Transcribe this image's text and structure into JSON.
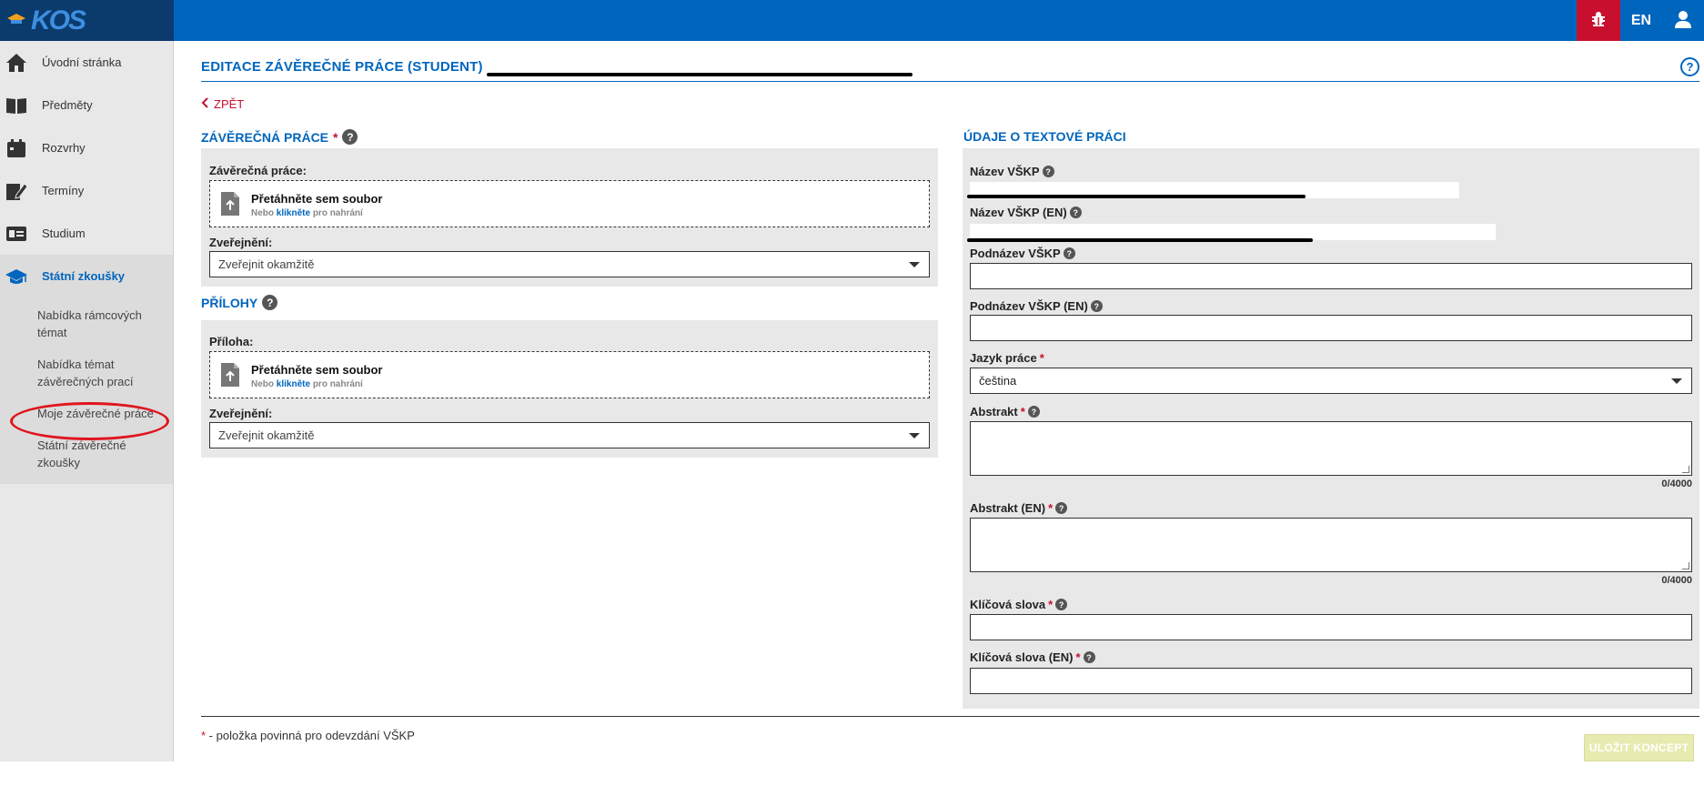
{
  "header": {
    "logo_text": "KOS",
    "lang_label": "EN",
    "brand_color": "#0065bd",
    "bug_color": "#c8102e"
  },
  "sidebar": {
    "items": [
      {
        "label": "Úvodní stránka",
        "icon": "home-icon"
      },
      {
        "label": "Předměty",
        "icon": "book-icon"
      },
      {
        "label": "Rozvrhy",
        "icon": "calendar-icon"
      },
      {
        "label": "Termíny",
        "icon": "edit-icon"
      },
      {
        "label": "Studium",
        "icon": "id-card-icon"
      },
      {
        "label": "Státní zkoušky",
        "icon": "graduation-cap-icon",
        "active": true
      }
    ],
    "subitems": [
      {
        "label": "Nabídka rámcových témat"
      },
      {
        "label": "Nabídka témat závěrečných prací"
      },
      {
        "label": "Moje závěrečné práce",
        "current": true
      },
      {
        "label": "Státní závěrečné zkoušky"
      }
    ]
  },
  "page": {
    "title": "EDITACE ZÁVĚREČNÉ PRÁCE (STUDENT)",
    "back_label": "ZPĚT",
    "help_symbol": "?"
  },
  "thesis_section": {
    "title": "ZÁVĚREČNÁ PRÁCE",
    "required_mark": "*",
    "file_label": "Závěrečná práce:",
    "drop_main": "Přetáhněte sem soubor",
    "drop_sub_prefix": "Nebo",
    "drop_sub_link": "klikněte",
    "drop_sub_suffix": "pro nahrání",
    "publish_label": "Zveřejnění:",
    "publish_value": "Zveřejnit okamžitě"
  },
  "attachments_section": {
    "title": "PŘÍLOHY",
    "file_label": "Příloha:",
    "drop_main": "Přetáhněte sem soubor",
    "drop_sub_prefix": "Nebo",
    "drop_sub_link": "klikněte",
    "drop_sub_suffix": "pro nahrání",
    "publish_label": "Zveřejnění:",
    "publish_value": "Zveřejnit okamžitě"
  },
  "text_section": {
    "title": "ÚDAJE O TEXTOVÉ PRÁCI",
    "name_label": "Název VŠKP",
    "name_en_label": "Název VŠKP (EN)",
    "subtitle_label": "Podnázev VŠKP",
    "subtitle_en_label": "Podnázev VŠKP (EN)",
    "language_label": "Jazyk práce",
    "language_value": "čeština",
    "abstract_label": "Abstrakt",
    "abstract_counter": "0/4000",
    "abstract_en_label": "Abstrakt (EN)",
    "abstract_en_counter": "0/4000",
    "keywords_label": "Klíčová slova",
    "keywords_en_label": "Klíčová slova (EN)",
    "required_mark": "*"
  },
  "footer": {
    "note_mark": "*",
    "note_text": " - položka povinná pro odevzdání VŠKP",
    "save_label": "ULOŽIT KONCEPT"
  }
}
